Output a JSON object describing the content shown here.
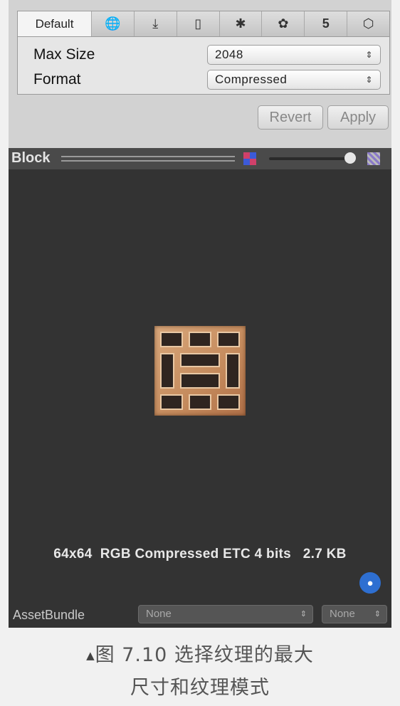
{
  "platform_tabs": {
    "default_label": "Default",
    "icons": [
      "globe-icon",
      "download-icon",
      "phone-icon",
      "android-icon",
      "blackberry-icon",
      "html5-icon",
      "unity-icon"
    ]
  },
  "settings": {
    "max_size": {
      "label": "Max Size",
      "value": "2048"
    },
    "format": {
      "label": "Format",
      "value": "Compressed"
    }
  },
  "actions": {
    "revert": "Revert",
    "apply": "Apply"
  },
  "preview": {
    "title": "Block",
    "info": "64x64  RGB Compressed ETC 4 bits   2.7 KB"
  },
  "asset_bundle": {
    "label": "AssetBundle",
    "name_value": "None",
    "variant_value": "None"
  },
  "caption": {
    "line1": "图 7.10   选择纹理的最大",
    "line2": "尺寸和纹理模式"
  },
  "colors": {
    "panel": "#d2d2d2",
    "preview_bg": "#333333",
    "tag_blue": "#2e6fd1"
  }
}
